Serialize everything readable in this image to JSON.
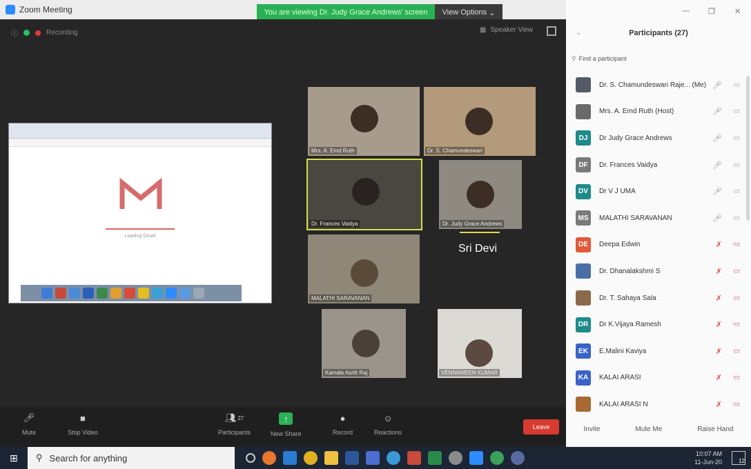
{
  "window": {
    "title": "Zoom Meeting"
  },
  "share_banner": {
    "text": "You are viewing Dr. Judy Grace Andrews' screen"
  },
  "view_options": {
    "label": "View Options"
  },
  "status": {
    "recording": "Recording",
    "speaker_view": "Speaker View"
  },
  "shared_screen": {
    "loading_text": "Loading Gmail"
  },
  "tiles": [
    {
      "name": "Mrs. A. Emd Ruth"
    },
    {
      "name": "Dr. S. Chamundeswari"
    },
    {
      "name": "Dr. Frances Vaidya"
    },
    {
      "name": "Dr. Judy Grace Andrews"
    },
    {
      "name": "MALATHI SARAVANAN"
    },
    {
      "name": "Sri Devi"
    },
    {
      "name": "Kamala Asritt Raj"
    },
    {
      "name": "VENNAMEEN KUMAR"
    }
  ],
  "toolbar": {
    "mute": "Mute",
    "stop_video": "Stop Video",
    "participants": "Participants",
    "participants_count": "27",
    "share_screen": "New Share",
    "record": "Record",
    "reactions": "Reactions",
    "leave": "Leave"
  },
  "panel": {
    "title": "Participants (27)",
    "search_placeholder": "Find a participant",
    "participants": [
      {
        "initials": "",
        "name": "Dr. S. Chamundeswari Raje... (Me)",
        "color": "#555b66",
        "muted": false
      },
      {
        "initials": "",
        "name": "Mrs. A. Emd Ruth (Host)",
        "color": "#6a6a6a",
        "muted": false
      },
      {
        "initials": "DJ",
        "name": "Dr Judy Grace Andrews",
        "color": "#1f8a8a",
        "muted": false
      },
      {
        "initials": "DF",
        "name": "Dr. Frances Vaidya",
        "color": "#7a7a7a",
        "muted": false
      },
      {
        "initials": "DV",
        "name": "Dr V J UMA",
        "color": "#1f8a8a",
        "muted": false
      },
      {
        "initials": "MS",
        "name": "MALATHI SARAVANAN",
        "color": "#7a7a7a",
        "muted": false
      },
      {
        "initials": "DE",
        "name": "Deepa Edwin",
        "color": "#e05a3a",
        "muted": true
      },
      {
        "initials": "",
        "name": "Dr. Dhanalakshmi S",
        "color": "#4a6fa5",
        "muted": true
      },
      {
        "initials": "",
        "name": "Dr. T. Sahaya Sala",
        "color": "#8a6a4a",
        "muted": true
      },
      {
        "initials": "DR",
        "name": "Dr K.Vijaya Ramesh",
        "color": "#1f8a8a",
        "muted": true
      },
      {
        "initials": "EK",
        "name": "E.Malini Kaviya",
        "color": "#3a62c8",
        "muted": true
      },
      {
        "initials": "KA",
        "name": "KALAI ARASI",
        "color": "#3a62c8",
        "muted": true
      },
      {
        "initials": "",
        "name": "KALAI ARASI N",
        "color": "#a86a30",
        "muted": true
      }
    ],
    "invite": "Invite",
    "mute_me": "Mute Me",
    "raise_hand": "Raise Hand"
  },
  "taskbar": {
    "search_placeholder": "Search for anything",
    "time": "10:07 AM",
    "date": "11-Jun-20",
    "notification_count": "12"
  }
}
